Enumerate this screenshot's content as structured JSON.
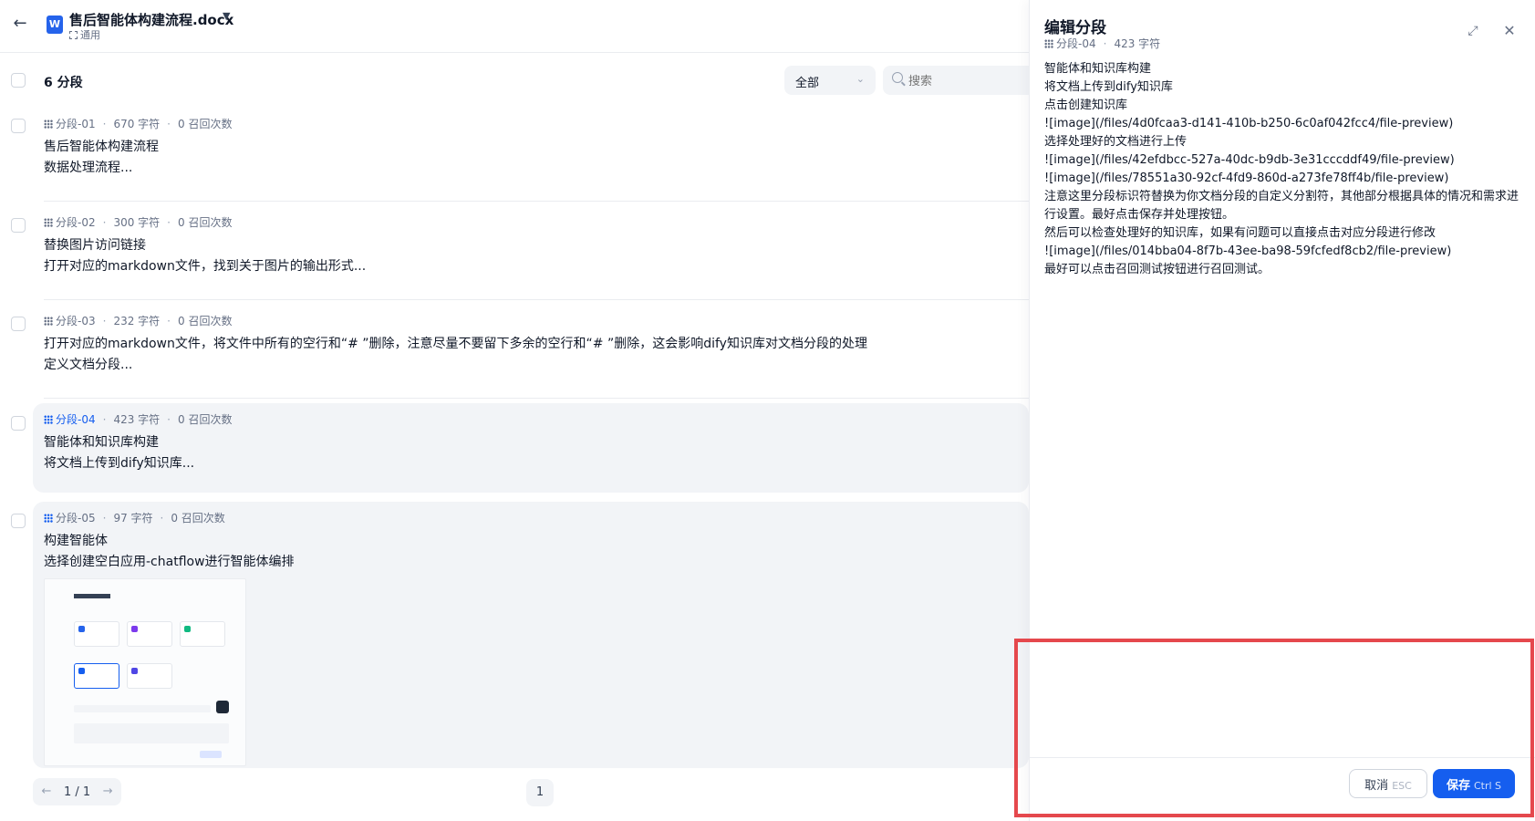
{
  "header": {
    "back_icon": "arrow-left-icon",
    "doc_icon_letter": "W",
    "doc_title": "售后智能体构建流程.docx",
    "doc_subtitle": "通用"
  },
  "list": {
    "count_label": "6 分段",
    "filter_value": "全部",
    "search_placeholder": "搜索"
  },
  "segments": [
    {
      "id": "分段-01",
      "chars": "670 字符",
      "recalls": "0 召回次数",
      "line1": "售后智能体构建流程",
      "line2": "数据处理流程..."
    },
    {
      "id": "分段-02",
      "chars": "300 字符",
      "recalls": "0 召回次数",
      "line1": "替换图片访问链接",
      "line2": "打开对应的markdown文件，找到关于图片的输出形式..."
    },
    {
      "id": "分段-03",
      "chars": "232 字符",
      "recalls": "0 召回次数",
      "line1": "打开对应的markdown文件，将文件中所有的空行和“# ”删除，注意尽量不要留下多余的空行和“# ”删除，这会影响dify知识库对文档分段的处理",
      "line2": "定义文档分段..."
    },
    {
      "id": "分段-04",
      "chars": "423 字符",
      "recalls": "0 召回次数",
      "line1": "智能体和知识库构建",
      "line2": "将文档上传到dify知识库..."
    },
    {
      "id": "分段-05",
      "chars": "97 字符",
      "recalls": "0 召回次数",
      "line1": "构建智能体",
      "line2": "选择创建空白应用-chatflow进行智能体编排"
    }
  ],
  "pagination": {
    "page_info": "1 / 1",
    "current_page": "1"
  },
  "drawer": {
    "title": "编辑分段",
    "seg_id": "分段-04",
    "seg_chars": "423 字符",
    "content": [
      "智能体和知识库构建",
      "将文档上传到dify知识库",
      "点击创建知识库",
      "![image](/files/4d0fcaa3-d141-410b-b250-6c0af042fcc4/file-preview)",
      "选择处理好的文档进行上传",
      "![image](/files/42efdbcc-527a-40dc-b9db-3e31cccddf49/file-preview)",
      "![image](/files/78551a30-92cf-4fd9-860d-a273fe78ff4b/file-preview)",
      "注意这里分段标识符替换为你文档分段的自定义分割符，其他部分根据具体的情况和需求进行设置。最好点击保存并处理按钮。",
      "然后可以检查处理好的知识库，如果有问题可以直接点击对应分段进行修改",
      "![image](/files/014bba04-8f7b-43ee-ba98-59fcfedf8cb2/file-preview)",
      "最好可以点击召回测试按钮进行召回测试。"
    ],
    "cancel_label": "取消",
    "cancel_kbd": "ESC",
    "save_label": "保存",
    "save_kbd": "Ctrl S"
  },
  "colors": {
    "accent": "#155eef",
    "highlight": "#e5484d"
  }
}
